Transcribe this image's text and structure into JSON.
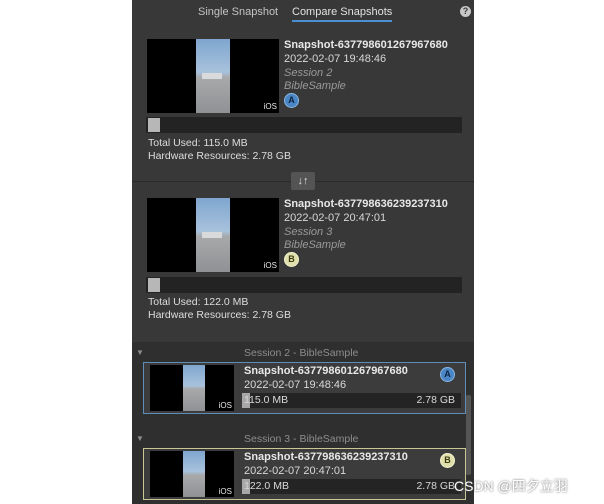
{
  "tabs": [
    {
      "label": "Single Snapshot",
      "active": false
    },
    {
      "label": "Compare Snapshots",
      "active": true
    }
  ],
  "help_label": "?",
  "snapshot_a": {
    "title": "Snapshot-637798601267967680",
    "date": "2022-02-07 19:48:46",
    "session": "Session 2",
    "project": "BibleSample",
    "platform": "iOS",
    "badge": "A",
    "total_used": "Total Used: 115.0 MB",
    "hardware": "Hardware Resources: 2.78 GB",
    "usage_fraction": 0.04
  },
  "swap_icon": "swap-vertical-icon",
  "swap_glyph": "↓↑",
  "snapshot_b": {
    "title": "Snapshot-637798636239237310",
    "date": "2022-02-07 20:47:01",
    "session": "Session 3",
    "project": "BibleSample",
    "platform": "iOS",
    "badge": "B",
    "total_used": "Total Used: 122.0 MB",
    "hardware": "Hardware Resources: 2.78 GB",
    "usage_fraction": 0.04
  },
  "session_list": [
    {
      "header": "Session 2 - BibleSample",
      "item": {
        "title": "Snapshot-637798601267967680",
        "date": "2022-02-07 19:48:46",
        "platform": "iOS",
        "used": "115.0 MB",
        "hardware": "2.78 GB",
        "badge": "A"
      }
    },
    {
      "header": "Session 3 - BibleSample",
      "item": {
        "title": "Snapshot-637798636239237310",
        "date": "2022-02-07 20:47:01",
        "platform": "iOS",
        "used": "122.0 MB",
        "hardware": "2.78 GB",
        "badge": "B"
      }
    }
  ],
  "colors": {
    "panel_bg": "#383838",
    "tab_underline": "#4a90d0",
    "badge_a": "#4a85c6",
    "badge_b": "#dfe0ac"
  },
  "watermark": "CSDN @四夕立羽"
}
